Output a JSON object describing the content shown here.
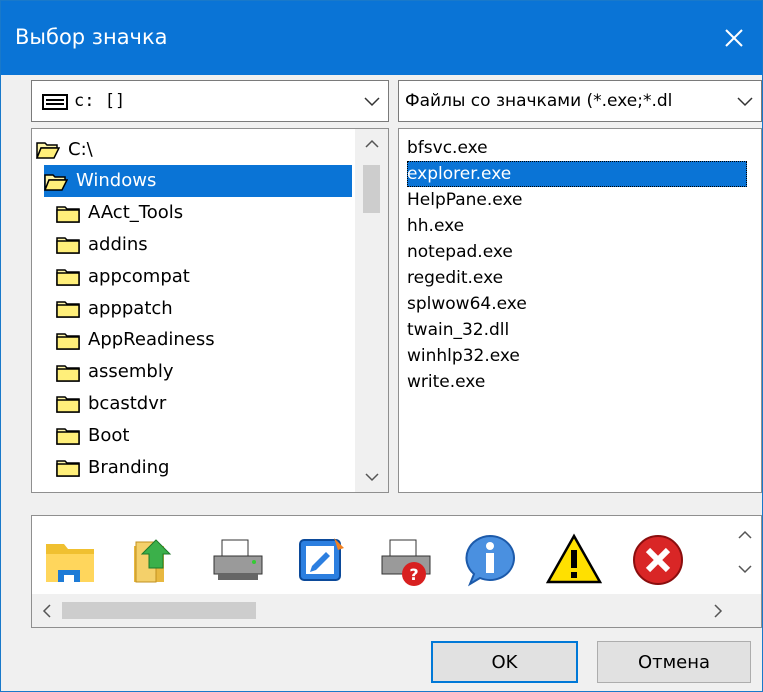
{
  "window": {
    "title": "Выбор значка"
  },
  "drive_combo": {
    "value": "c: []"
  },
  "filter_combo": {
    "value": "Файлы со значками (*.exe;*.dl"
  },
  "tree": {
    "items": [
      {
        "label": "C:\\",
        "indent": 0,
        "open": true
      },
      {
        "label": "Windows",
        "indent": 1,
        "open": true,
        "selected": true
      },
      {
        "label": "AAct_Tools",
        "indent": 2
      },
      {
        "label": "addins",
        "indent": 2
      },
      {
        "label": "appcompat",
        "indent": 2
      },
      {
        "label": "apppatch",
        "indent": 2
      },
      {
        "label": "AppReadiness",
        "indent": 2
      },
      {
        "label": "assembly",
        "indent": 2
      },
      {
        "label": "bcastdvr",
        "indent": 2
      },
      {
        "label": "Boot",
        "indent": 2
      },
      {
        "label": "Branding",
        "indent": 2
      }
    ]
  },
  "files": {
    "items": [
      {
        "label": "bfsvc.exe"
      },
      {
        "label": "explorer.exe",
        "selected": true
      },
      {
        "label": "HelpPane.exe"
      },
      {
        "label": "hh.exe"
      },
      {
        "label": "notepad.exe"
      },
      {
        "label": "regedit.exe"
      },
      {
        "label": "splwow64.exe"
      },
      {
        "label": "twain_32.dll"
      },
      {
        "label": "winhlp32.exe"
      },
      {
        "label": "write.exe"
      }
    ]
  },
  "icon_strip": {
    "icons": [
      "folder-blue-icon",
      "folder-arrow-icon",
      "printer-icon",
      "edit-document-icon",
      "printer-help-icon",
      "info-icon",
      "warning-icon",
      "error-icon"
    ]
  },
  "buttons": {
    "ok": "OK",
    "cancel": "Отмена"
  },
  "colors": {
    "accent": "#0a74d6",
    "title_bar": "#0a74d6"
  }
}
